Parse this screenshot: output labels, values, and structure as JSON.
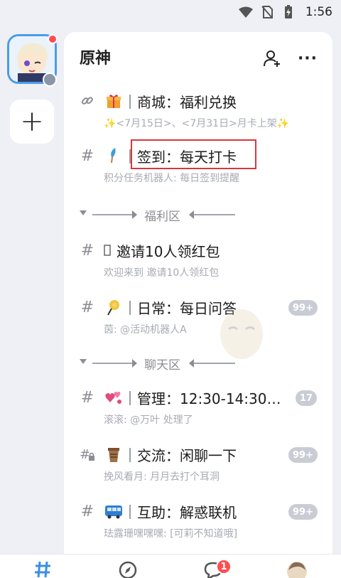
{
  "status_bar": {
    "time": "1:56"
  },
  "guild": {
    "name": "原神"
  },
  "channels": [
    {
      "prefix": "link",
      "emoji": "gift-icon",
      "name": "商城：福利兑换",
      "sub": "✨<7月15日>、<7月31日>月卡上架✨"
    },
    {
      "prefix": "#",
      "emoji": "feather-icon",
      "name": "签到：每天打卡",
      "sub": "积分任务机器人: 每日签到提醒"
    },
    {
      "prefix": "#",
      "emoji": "",
      "name": "邀请10人领红包",
      "sub": "欢迎来到 邀请10人领红包"
    },
    {
      "prefix": "#",
      "emoji": "lollipop-icon",
      "name": "日常：每日问答",
      "sub": "茵: @活动机器人A",
      "badge": "99+"
    },
    {
      "prefix": "#",
      "emoji": "hearts-icon",
      "name": "管理：12:30-14:30滚...",
      "sub": "滚滚: @万叶 处理了",
      "badge": "17"
    },
    {
      "prefix": "lock-hash",
      "emoji": "drink-icon",
      "name": "交流：闲聊一下",
      "sub": "挽风看月: 月月去打个耳洞",
      "badge": "99+"
    },
    {
      "prefix": "#",
      "emoji": "bus-icon",
      "name": "互助：解惑联机",
      "sub": "珐露珊嘿嘿嘿: [可莉不知道哦]",
      "badge": "99+"
    }
  ],
  "categories": [
    {
      "name": "福利区"
    },
    {
      "name": "聊天区"
    }
  ],
  "tabbar": {
    "badge": "1"
  },
  "colors": {
    "accent": "#4a9ce8",
    "highlight": "#d9363e",
    "badge": "#c9ccd4",
    "notify": "#ff4d4f"
  }
}
